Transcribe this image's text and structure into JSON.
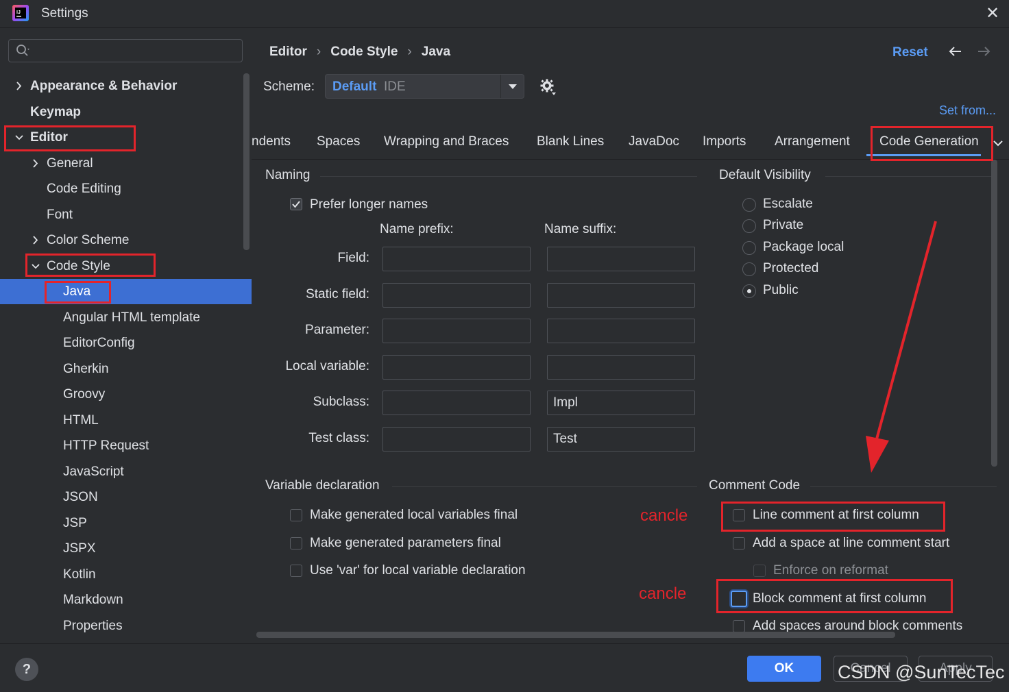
{
  "window": {
    "title": "Settings"
  },
  "search": {
    "placeholder": "",
    "value": ""
  },
  "sidebar": {
    "items": [
      {
        "label": "Appearance & Behavior"
      },
      {
        "label": "Keymap"
      },
      {
        "label": "Editor"
      },
      {
        "label": "General"
      },
      {
        "label": "Code Editing"
      },
      {
        "label": "Font"
      },
      {
        "label": "Color Scheme"
      },
      {
        "label": "Code Style"
      },
      {
        "label": "Java"
      },
      {
        "label": "Angular HTML template"
      },
      {
        "label": "EditorConfig"
      },
      {
        "label": "Gherkin"
      },
      {
        "label": "Groovy"
      },
      {
        "label": "HTML"
      },
      {
        "label": "HTTP Request"
      },
      {
        "label": "JavaScript"
      },
      {
        "label": "JSON"
      },
      {
        "label": "JSP"
      },
      {
        "label": "JSPX"
      },
      {
        "label": "Kotlin"
      },
      {
        "label": "Markdown"
      },
      {
        "label": "Properties"
      }
    ],
    "selected": "Java"
  },
  "breadcrumb": [
    "Editor",
    "Code Style",
    "Java"
  ],
  "header": {
    "reset": "Reset"
  },
  "scheme": {
    "label": "Scheme:",
    "name": "Default",
    "type": "IDE",
    "set_from": "Set from..."
  },
  "tabs": {
    "items": [
      "ndents",
      "Spaces",
      "Wrapping and Braces",
      "Blank Lines",
      "JavaDoc",
      "Imports",
      "Arrangement",
      "Code Generation"
    ],
    "active": "Code Generation"
  },
  "naming": {
    "title": "Naming",
    "prefer_longer": {
      "label": "Prefer longer names",
      "checked": true
    },
    "prefix_header": "Name prefix:",
    "suffix_header": "Name suffix:",
    "rows": [
      {
        "label": "Field:",
        "prefix": "",
        "suffix": ""
      },
      {
        "label": "Static field:",
        "prefix": "",
        "suffix": ""
      },
      {
        "label": "Parameter:",
        "prefix": "",
        "suffix": ""
      },
      {
        "label": "Local variable:",
        "prefix": "",
        "suffix": ""
      },
      {
        "label": "Subclass:",
        "prefix": "",
        "suffix": "Impl"
      },
      {
        "label": "Test class:",
        "prefix": "",
        "suffix": "Test"
      }
    ]
  },
  "visibility": {
    "title": "Default Visibility",
    "options": [
      "Escalate",
      "Private",
      "Package local",
      "Protected",
      "Public"
    ],
    "selected": "Public"
  },
  "variable_declaration": {
    "title": "Variable declaration",
    "options": [
      {
        "label": "Make generated local variables final",
        "checked": false
      },
      {
        "label": "Make generated parameters final",
        "checked": false
      },
      {
        "label": "Use 'var' for local variable declaration",
        "checked": false
      }
    ]
  },
  "comment_code": {
    "title": "Comment Code",
    "options": [
      {
        "label": "Line comment at first column",
        "checked": false
      },
      {
        "label": "Add a space at line comment start",
        "checked": false
      },
      {
        "label": "Enforce on reformat",
        "checked": false
      },
      {
        "label": "Block comment at first column",
        "checked": false
      },
      {
        "label": "Add spaces around block comments",
        "checked": false
      }
    ]
  },
  "annotations": {
    "note1": "cancle",
    "note2": "cancle"
  },
  "footer": {
    "help": "?",
    "ok": "OK",
    "cancel": "Cancel",
    "apply": "Apply"
  },
  "watermark": "CSDN @SunTecTec",
  "colors": {
    "accent": "#5b9cf5",
    "selection": "#3d6fd3",
    "annotation": "#e3242b",
    "background": "#2b2d30"
  }
}
